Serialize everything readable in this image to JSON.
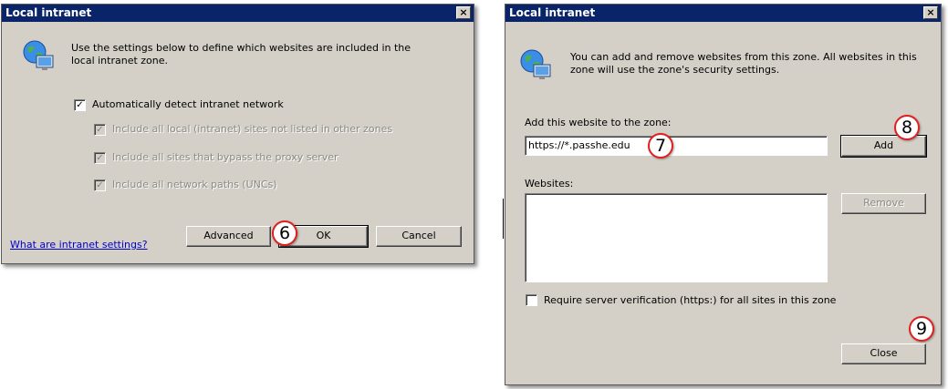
{
  "left_dialog": {
    "title": "Local intranet",
    "close_glyph": "×",
    "description": "Use the settings below to define which websites are included in the local intranet zone.",
    "auto_detect": {
      "label": "Automatically detect intranet network",
      "checked": true
    },
    "options": [
      {
        "label": "Include all local (intranet) sites not listed in other zones",
        "checked": true,
        "enabled": false
      },
      {
        "label": "Include all sites that bypass the proxy server",
        "checked": true,
        "enabled": false
      },
      {
        "label": "Include all network paths (UNCs)",
        "checked": true,
        "enabled": false
      }
    ],
    "help_link": "What are intranet settings?",
    "advanced_button": "Advanced",
    "ok_button": "OK",
    "cancel_button": "Cancel",
    "step_marker": "6"
  },
  "right_dialog": {
    "title": "Local intranet",
    "close_glyph": "×",
    "description": "You can add and remove websites from this zone. All websites in this zone will use the zone's security settings.",
    "add_label": "Add this website to the zone:",
    "website_value": "https://*.passhe.edu",
    "add_button": "Add",
    "websites_label": "Websites:",
    "websites": [],
    "remove_button": "Remove",
    "require_https": {
      "label": "Require server verification (https:) for all sites in this zone",
      "checked": false
    },
    "close_button": "Close",
    "markers": {
      "website_field": "7",
      "add": "8",
      "close": "9"
    }
  },
  "colors": {
    "dialog_face": "#d4d0c8",
    "titlebar": "#0a246a",
    "link": "#0000cc",
    "marker_ring": "#e02020"
  },
  "icons": {
    "zone": "globe-computer-icon",
    "check": "✓"
  }
}
